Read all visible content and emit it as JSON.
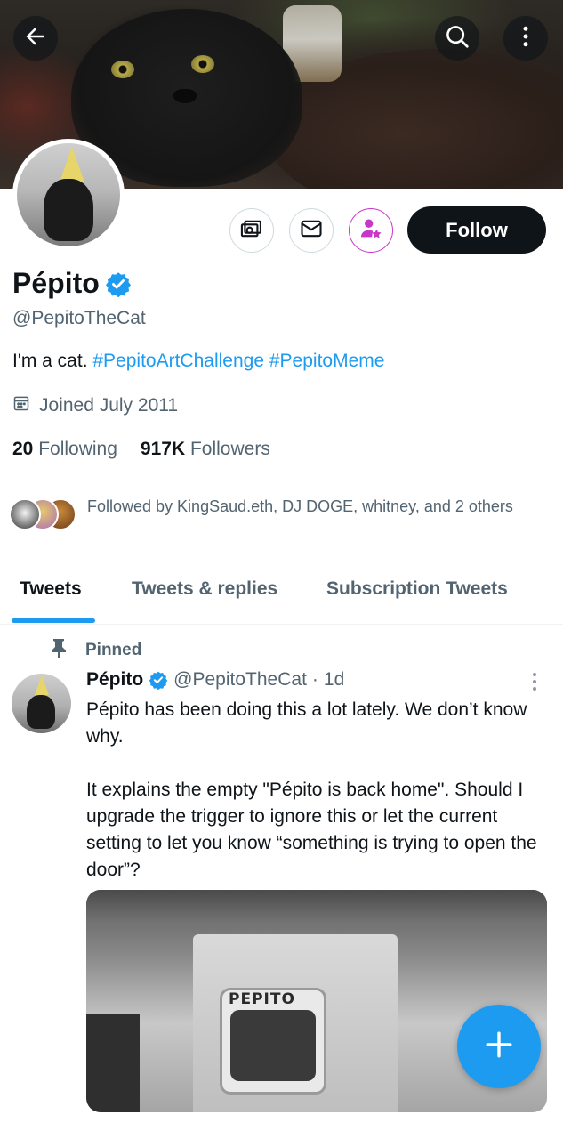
{
  "header": {
    "back_icon": "arrow-left-icon",
    "search_icon": "search-icon",
    "more_icon": "more-vertical-icon"
  },
  "profile": {
    "display_name": "Pépito",
    "handle": "@PepitoTheCat",
    "bio_text": "I'm a cat. ",
    "bio_hashtag_1": "#PepitoArtChallenge",
    "bio_hashtag_2": "#PepitoMeme",
    "joined": "Joined July 2011",
    "following_count": "20",
    "following_label": "Following",
    "followers_count": "917K",
    "followers_label": "Followers",
    "followed_by": "Followed by KingSaud.eth, DJ DOGE, whitney, and 2 others",
    "follow_label": "Follow"
  },
  "actions": {
    "subscribe_icon": "subscribe-money-icon",
    "message_icon": "envelope-icon",
    "notify_icon": "person-star-icon"
  },
  "tabs": [
    {
      "label": "Tweets",
      "active": true
    },
    {
      "label": "Tweets & replies",
      "active": false
    },
    {
      "label": "Subscription Tweets",
      "active": false
    }
  ],
  "tweet": {
    "pinned_label": "Pinned",
    "author_name": "Pépito",
    "author_handle": "@PepitoTheCat",
    "separator": "·",
    "time": "1d",
    "text_line_1": "Pépito has been doing this a lot lately. We don’t know why.",
    "text_line_2": "It explains the empty \"Pépito is back home\". Should I upgrade the trigger to ignore this or let the current setting to let you know “something is trying to open the door”?",
    "media_label": "PEPITO"
  },
  "fab": {
    "icon": "plus-icon"
  },
  "colors": {
    "accent": "#1d9bf0",
    "text_primary": "#0f1419",
    "text_secondary": "#536471",
    "notify_accent": "#c837c8"
  }
}
